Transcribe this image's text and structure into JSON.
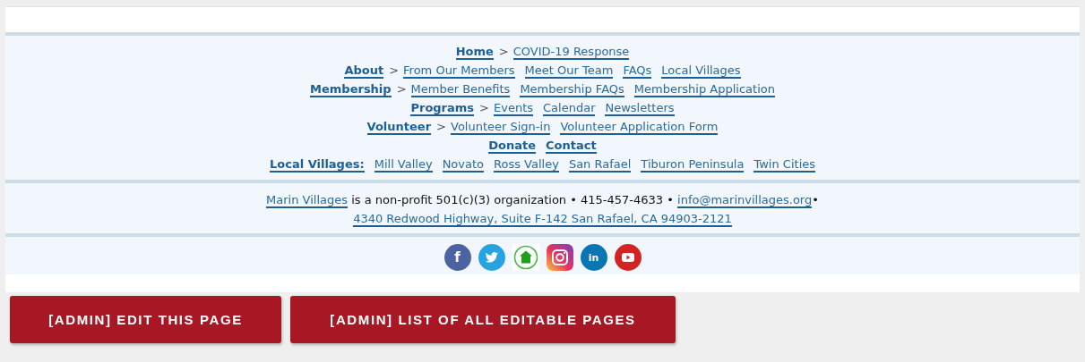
{
  "nav_rows": [
    {
      "items": [
        {
          "kind": "section",
          "text": "Home"
        },
        {
          "kind": "separator",
          "text": ">"
        },
        {
          "kind": "link",
          "text": "COVID-19 Response"
        }
      ]
    },
    {
      "items": [
        {
          "kind": "section",
          "text": "About"
        },
        {
          "kind": "separator",
          "text": ">"
        },
        {
          "kind": "link",
          "text": "From Our Members"
        },
        {
          "kind": "link",
          "text": "Meet Our Team"
        },
        {
          "kind": "link",
          "text": "FAQs"
        },
        {
          "kind": "link",
          "text": "Local Villages"
        }
      ]
    },
    {
      "items": [
        {
          "kind": "section",
          "text": "Membership"
        },
        {
          "kind": "separator",
          "text": ">"
        },
        {
          "kind": "link",
          "text": "Member Benefits"
        },
        {
          "kind": "link",
          "text": "Membership FAQs"
        },
        {
          "kind": "link",
          "text": "Membership Application"
        }
      ]
    },
    {
      "items": [
        {
          "kind": "section",
          "text": "Programs"
        },
        {
          "kind": "separator",
          "text": ">"
        },
        {
          "kind": "link",
          "text": "Events"
        },
        {
          "kind": "link",
          "text": "Calendar"
        },
        {
          "kind": "link",
          "text": "Newsletters"
        }
      ]
    },
    {
      "items": [
        {
          "kind": "section",
          "text": "Volunteer"
        },
        {
          "kind": "separator",
          "text": ">"
        },
        {
          "kind": "link",
          "text": "Volunteer Sign-in"
        },
        {
          "kind": "link",
          "text": "Volunteer Application Form"
        }
      ]
    },
    {
      "items": [
        {
          "kind": "section",
          "text": "Donate"
        },
        {
          "kind": "section",
          "text": "Contact"
        }
      ]
    },
    {
      "items": [
        {
          "kind": "section",
          "text": "Local Villages:"
        },
        {
          "kind": "link",
          "text": "Mill Valley"
        },
        {
          "kind": "link",
          "text": "Novato"
        },
        {
          "kind": "link",
          "text": "Ross Valley"
        },
        {
          "kind": "link",
          "text": "San Rafael"
        },
        {
          "kind": "link",
          "text": "Tiburon Peninsula"
        },
        {
          "kind": "link",
          "text": "Twin Cities"
        }
      ]
    }
  ],
  "org_info": {
    "name_link": "Marin Villages",
    "text": " is a non-profit 501(c)(3) organization • 415-457-4633 • ",
    "email_link": "info@marinvillages.org",
    "trailing": "•",
    "address_link": "4340 Redwood Highway, Suite F-142 San Rafael, CA 94903-2121"
  },
  "social": [
    {
      "kind": "facebook",
      "glyph": "f"
    },
    {
      "kind": "twitter"
    },
    {
      "kind": "house"
    },
    {
      "kind": "instagram"
    },
    {
      "kind": "linkedin",
      "glyph": "in"
    },
    {
      "kind": "youtube"
    }
  ],
  "admin_buttons": [
    "[ADMIN] EDIT THIS PAGE",
    "[ADMIN] LIST OF ALL EDITABLE PAGES"
  ]
}
